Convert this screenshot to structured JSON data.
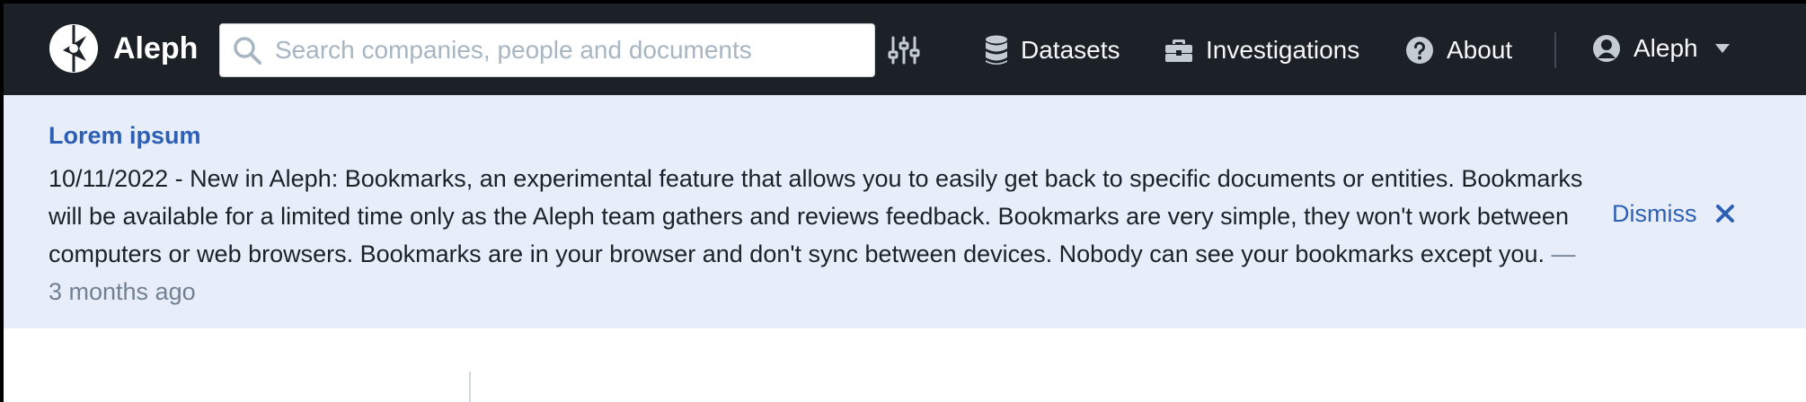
{
  "navbar": {
    "brand": "Aleph",
    "search": {
      "placeholder": "Search companies, people and documents",
      "value": ""
    },
    "items": [
      {
        "label": "Datasets",
        "icon": "database-icon"
      },
      {
        "label": "Investigations",
        "icon": "briefcase-icon"
      },
      {
        "label": "About",
        "icon": "help-icon"
      }
    ],
    "user": {
      "label": "Aleph",
      "icon": "user-icon"
    }
  },
  "banner": {
    "title": "Lorem ipsum",
    "body": "10/11/2022 - New in Aleph: Bookmarks, an experimental feature that allows you to easily get back to specific documents or entities. Bookmarks will be available for a limited time only as the Aleph team gathers and reviews feedback. Bookmarks are very simple, they won't work between computers or web browsers. Bookmarks are in your browser and don't sync between devices. Nobody can see your bookmarks except you.",
    "time": "— 3 months ago",
    "dismiss": "Dismiss"
  },
  "colors": {
    "navbar_bg": "#1c2127",
    "banner_bg": "#e7eef9",
    "accent": "#2d5fb4",
    "muted": "#738091"
  }
}
